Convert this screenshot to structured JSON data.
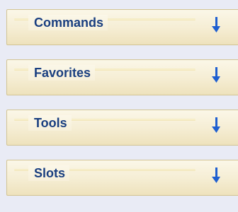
{
  "panels": [
    {
      "label": "Commands",
      "icon": "down-arrow-icon"
    },
    {
      "label": "Favorites",
      "icon": "down-arrow-icon"
    },
    {
      "label": "Tools",
      "icon": "down-arrow-icon"
    },
    {
      "label": "Slots",
      "icon": "down-arrow-icon"
    }
  ],
  "colors": {
    "background": "#e9ebf5",
    "label": "#1a3f80",
    "arrow": "#1f5fd0",
    "panel_border": "#d2c493"
  }
}
